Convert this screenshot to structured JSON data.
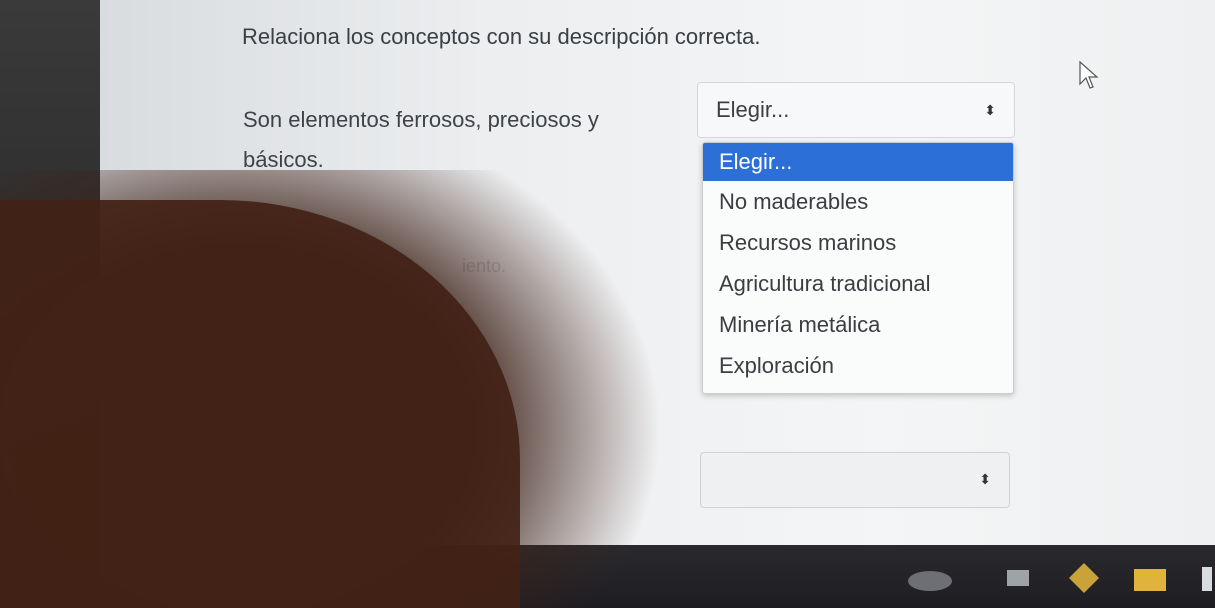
{
  "question": {
    "text": "Relaciona los conceptos con su descripción correcta."
  },
  "row1": {
    "concept": "Son elementos ferrosos, preciosos y básicos.",
    "select_value": "Elegir...",
    "options": [
      "Elegir...",
      "No maderables",
      "Recursos marinos",
      "Agricultura tradicional",
      "Minería metálica",
      "Exploración"
    ],
    "selected_index": 0
  },
  "faint_text": "iento.",
  "colors": {
    "highlight": "#2c6fd6",
    "text": "#3a3e42"
  }
}
